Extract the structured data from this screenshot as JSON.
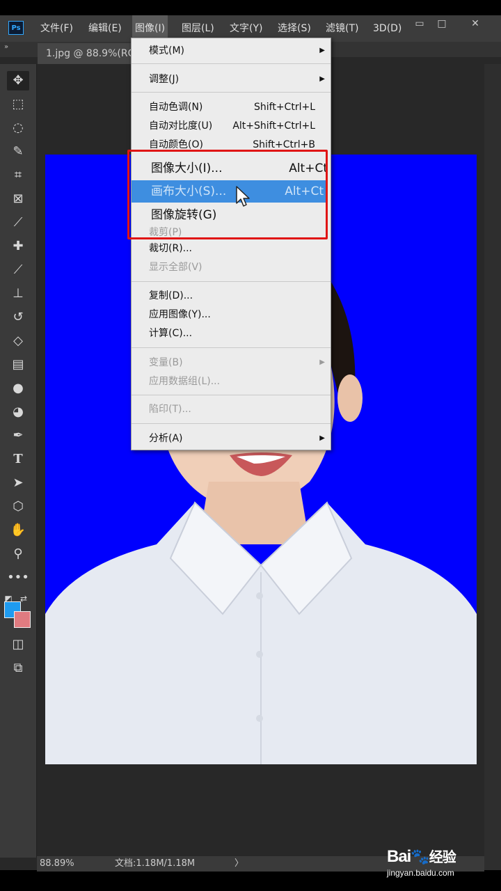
{
  "menubar": {
    "logo": "Ps",
    "items": [
      "文件(F)",
      "编辑(E)",
      "图像(I)",
      "图层(L)",
      "文字(Y)",
      "选择(S)",
      "滤镜(T)",
      "3D(D)"
    ],
    "active_index": 2
  },
  "window_buttons": [
    "▭",
    "□",
    "✕"
  ],
  "document_tab": {
    "label": "1.jpg @ 88.9%(RG"
  },
  "image_menu": {
    "items": [
      {
        "label": "模式(M)",
        "submenu": true
      },
      {
        "label": "调整(J)",
        "submenu": true
      },
      {
        "label": "自动色调(N)",
        "shortcut": "Shift+Ctrl+L"
      },
      {
        "label": "自动对比度(U)",
        "shortcut": "Alt+Shift+Ctrl+L"
      },
      {
        "label": "自动颜色(O)",
        "shortcut": "Shift+Ctrl+B"
      },
      {
        "label": "图像大小(I)...",
        "shortcut": "Alt+Ct"
      },
      {
        "label": "画布大小(S)...",
        "shortcut": "Alt+Ct",
        "highlighted": true
      },
      {
        "label": "图像旋转(G)"
      },
      {
        "label": "裁剪(P)",
        "disabled": true
      },
      {
        "label": "裁切(R)..."
      },
      {
        "label": "显示全部(V)",
        "disabled": true
      },
      {
        "label": "复制(D)..."
      },
      {
        "label": "应用图像(Y)..."
      },
      {
        "label": "计算(C)..."
      },
      {
        "label": "变量(B)",
        "submenu": true,
        "disabled": true
      },
      {
        "label": "应用数据组(L)...",
        "disabled": true
      },
      {
        "label": "陷印(T)...",
        "disabled": true
      },
      {
        "label": "分析(A)",
        "submenu": true
      }
    ]
  },
  "statusbar": {
    "zoom": "88.89%",
    "doc_info": "文档:1.18M/1.18M",
    "arrow": "〉"
  },
  "watermark": {
    "brand": "Bai",
    "brand2": "经验",
    "url": "jingyan.baidu.com"
  },
  "colors": {
    "canvas_background": "#0000fe",
    "highlight": "#3e8ee0",
    "annotation_box": "#e01515",
    "foreground_color": "#1e9bf0",
    "background_color": "#e07b80"
  }
}
